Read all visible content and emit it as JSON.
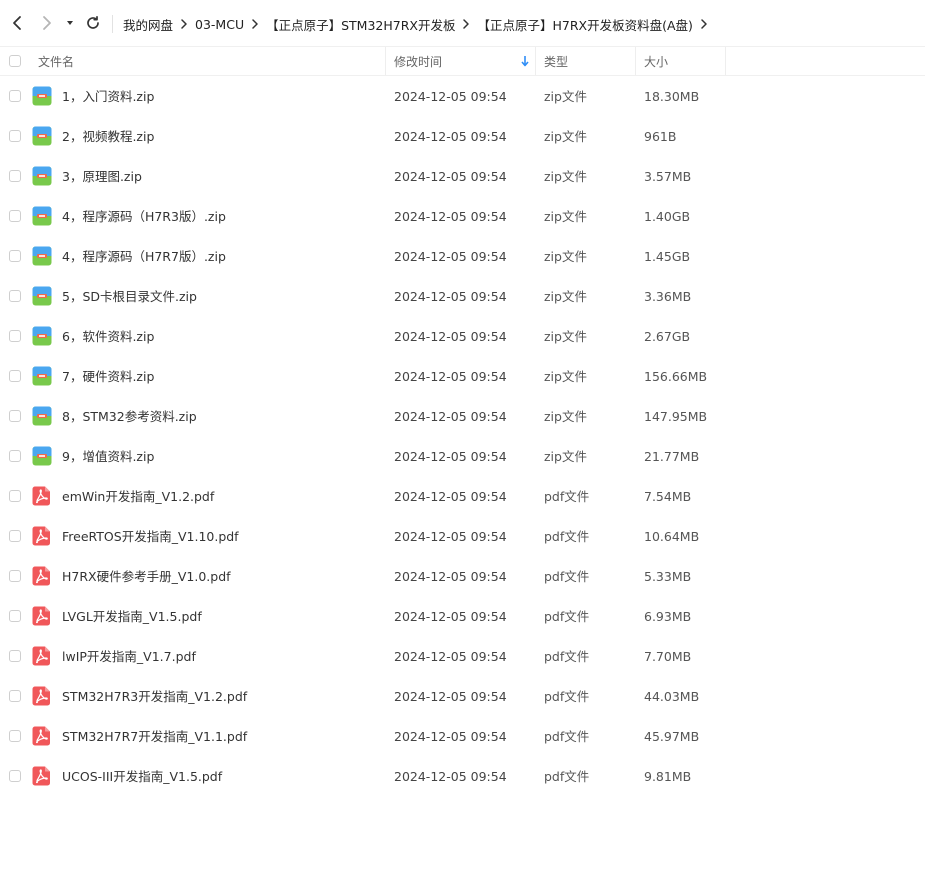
{
  "toolbar": {
    "back_icon": "chevron-left-icon",
    "forward_icon": "chevron-right-icon",
    "history_dropdown_icon": "caret-down-icon",
    "refresh_icon": "refresh-icon"
  },
  "breadcrumb": [
    "我的网盘",
    "03-MCU",
    "【正点原子】STM32H7RX开发板",
    "【正点原子】H7RX开发板资料盘(A盘)"
  ],
  "columns": {
    "name": "文件名",
    "modified": "修改时间",
    "type": "类型",
    "size": "大小",
    "sort_icon": "sort-down-arrow-icon",
    "sort_color": "#2f8ef6"
  },
  "colors": {
    "zip_icon_top": "#4aa7f0",
    "zip_icon_bottom": "#78c94b",
    "zip_icon_stripe": "#f06a4b",
    "pdf_icon": "#f0575a"
  },
  "files": [
    {
      "name": "1，入门资料.zip",
      "time": "2024-12-05 09:54",
      "type": "zip文件",
      "size": "18.30MB",
      "kind": "zip"
    },
    {
      "name": "2，视频教程.zip",
      "time": "2024-12-05 09:54",
      "type": "zip文件",
      "size": "961B",
      "kind": "zip"
    },
    {
      "name": "3，原理图.zip",
      "time": "2024-12-05 09:54",
      "type": "zip文件",
      "size": "3.57MB",
      "kind": "zip"
    },
    {
      "name": "4，程序源码（H7R3版）.zip",
      "time": "2024-12-05 09:54",
      "type": "zip文件",
      "size": "1.40GB",
      "kind": "zip"
    },
    {
      "name": "4，程序源码（H7R7版）.zip",
      "time": "2024-12-05 09:54",
      "type": "zip文件",
      "size": "1.45GB",
      "kind": "zip"
    },
    {
      "name": "5，SD卡根目录文件.zip",
      "time": "2024-12-05 09:54",
      "type": "zip文件",
      "size": "3.36MB",
      "kind": "zip"
    },
    {
      "name": "6，软件资料.zip",
      "time": "2024-12-05 09:54",
      "type": "zip文件",
      "size": "2.67GB",
      "kind": "zip"
    },
    {
      "name": "7，硬件资料.zip",
      "time": "2024-12-05 09:54",
      "type": "zip文件",
      "size": "156.66MB",
      "kind": "zip"
    },
    {
      "name": "8，STM32参考资料.zip",
      "time": "2024-12-05 09:54",
      "type": "zip文件",
      "size": "147.95MB",
      "kind": "zip"
    },
    {
      "name": "9，增值资料.zip",
      "time": "2024-12-05 09:54",
      "type": "zip文件",
      "size": "21.77MB",
      "kind": "zip"
    },
    {
      "name": "emWin开发指南_V1.2.pdf",
      "time": "2024-12-05 09:54",
      "type": "pdf文件",
      "size": "7.54MB",
      "kind": "pdf"
    },
    {
      "name": "FreeRTOS开发指南_V1.10.pdf",
      "time": "2024-12-05 09:54",
      "type": "pdf文件",
      "size": "10.64MB",
      "kind": "pdf"
    },
    {
      "name": "H7RX硬件参考手册_V1.0.pdf",
      "time": "2024-12-05 09:54",
      "type": "pdf文件",
      "size": "5.33MB",
      "kind": "pdf"
    },
    {
      "name": "LVGL开发指南_V1.5.pdf",
      "time": "2024-12-05 09:54",
      "type": "pdf文件",
      "size": "6.93MB",
      "kind": "pdf"
    },
    {
      "name": "lwIP开发指南_V1.7.pdf",
      "time": "2024-12-05 09:54",
      "type": "pdf文件",
      "size": "7.70MB",
      "kind": "pdf"
    },
    {
      "name": "STM32H7R3开发指南_V1.2.pdf",
      "time": "2024-12-05 09:54",
      "type": "pdf文件",
      "size": "44.03MB",
      "kind": "pdf"
    },
    {
      "name": "STM32H7R7开发指南_V1.1.pdf",
      "time": "2024-12-05 09:54",
      "type": "pdf文件",
      "size": "45.97MB",
      "kind": "pdf"
    },
    {
      "name": "UCOS-III开发指南_V1.5.pdf",
      "time": "2024-12-05 09:54",
      "type": "pdf文件",
      "size": "9.81MB",
      "kind": "pdf"
    }
  ]
}
